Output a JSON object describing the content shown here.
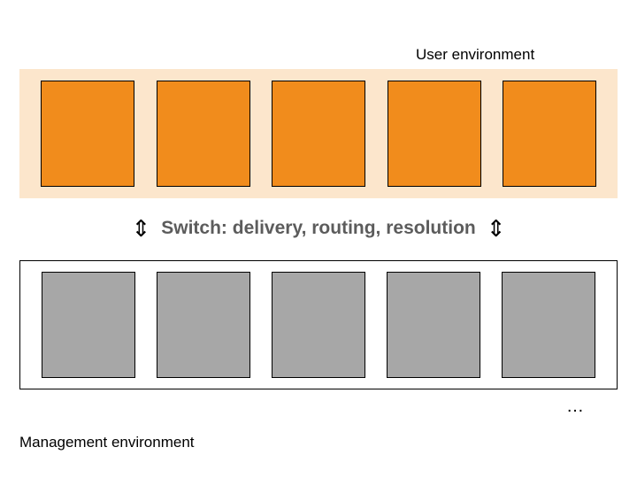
{
  "labels": {
    "user_env": "User environment",
    "switch": "Switch: delivery, routing, resolution",
    "mgmt_env": "Management environment",
    "ellipsis": "…"
  },
  "top_boxes": 5,
  "bottom_boxes": 5,
  "colors": {
    "top_band_bg": "#FCE6CC",
    "top_box": "#F18C1C",
    "bottom_box": "#a7a7a7",
    "switch_text": "#5c5c5c"
  }
}
